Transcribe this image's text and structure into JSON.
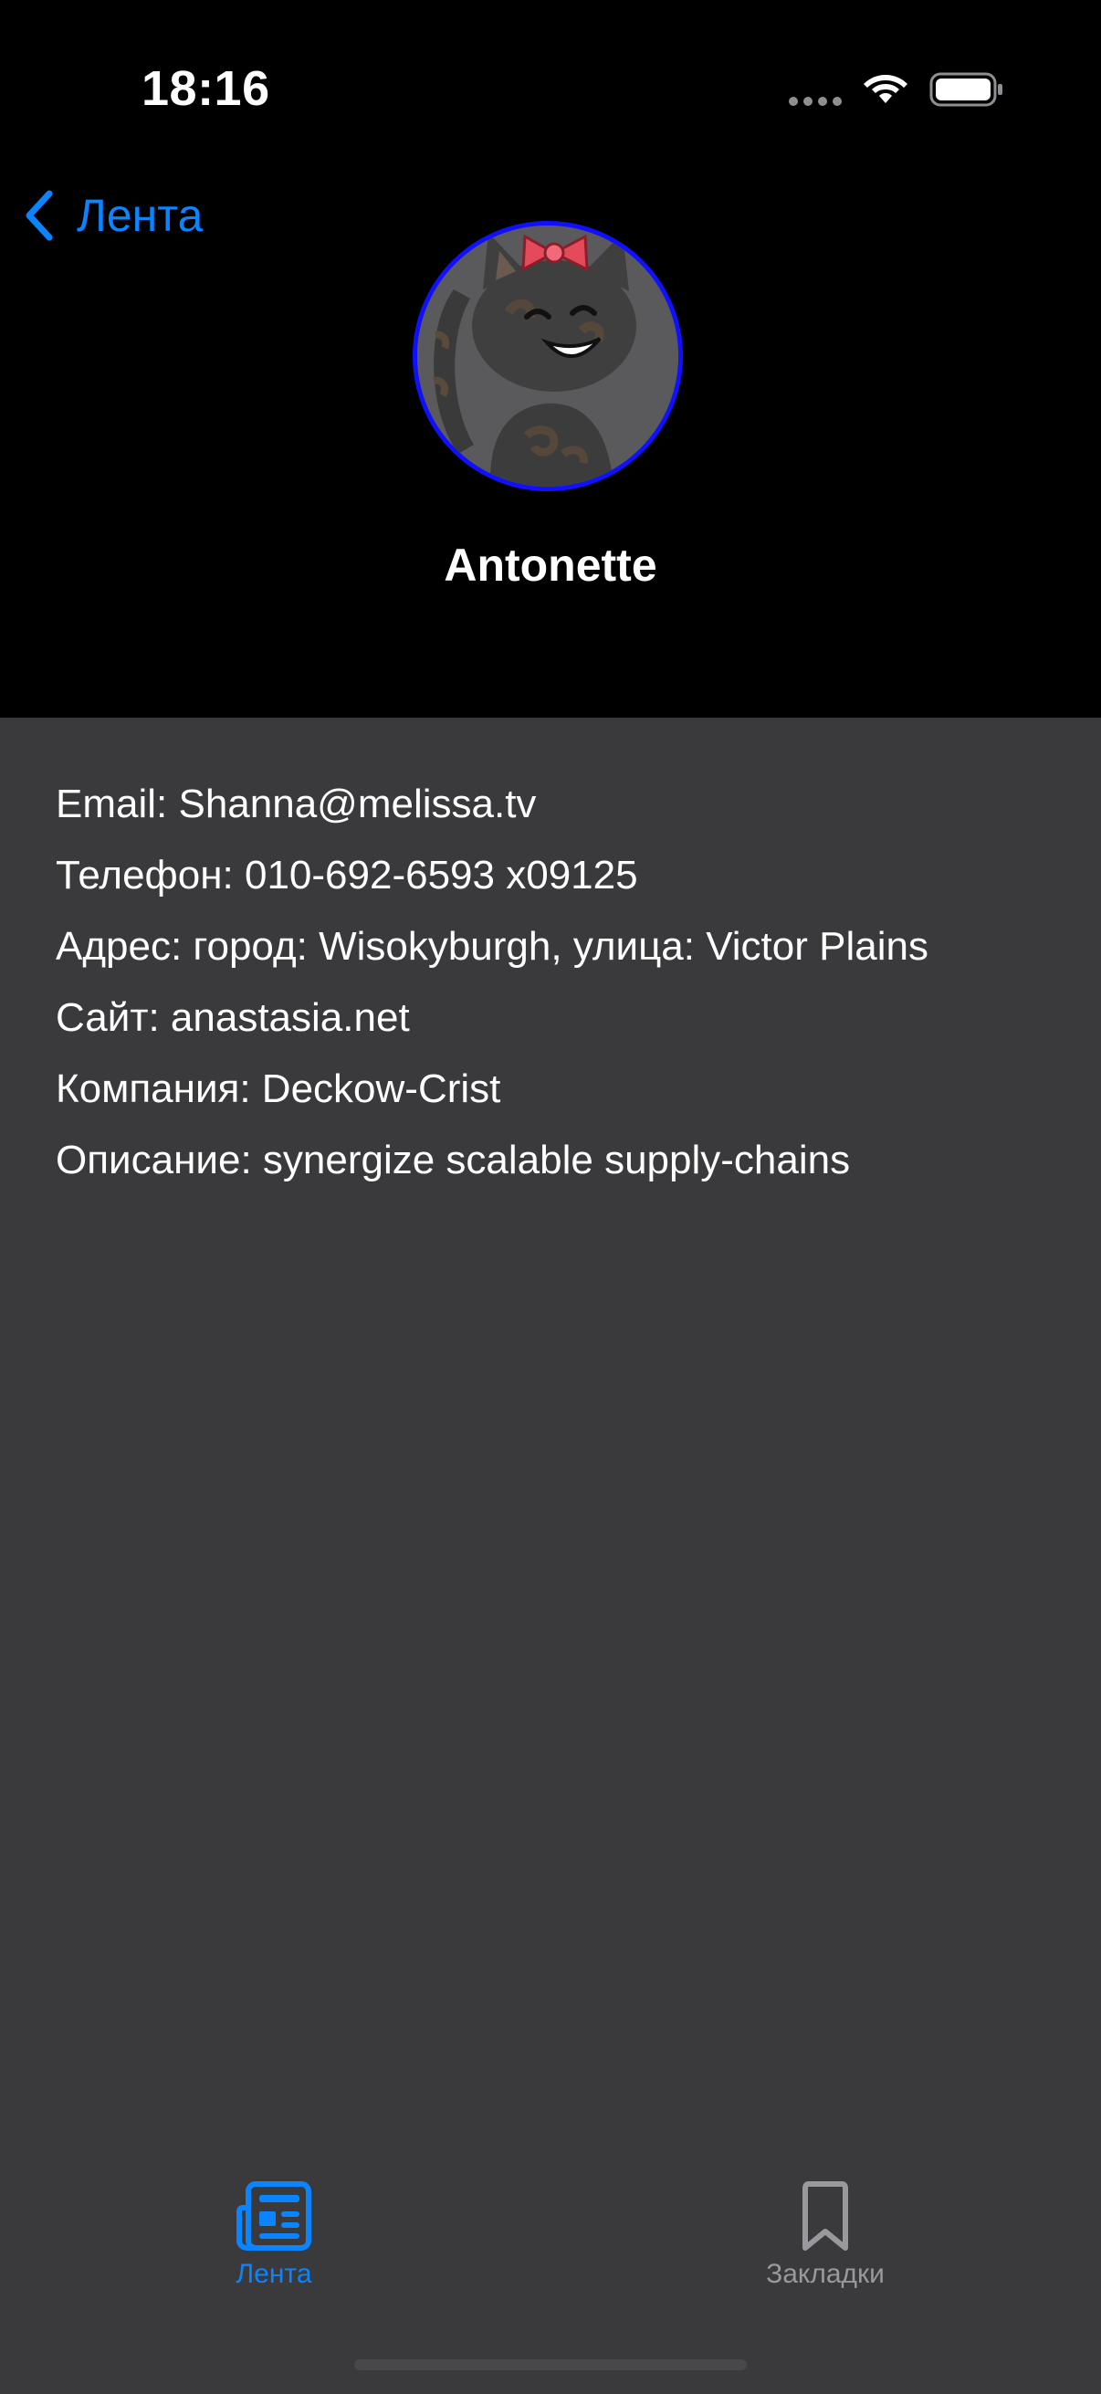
{
  "status_bar": {
    "time": "18:16"
  },
  "nav": {
    "back_label": "Лента"
  },
  "profile": {
    "name": "Antonette",
    "avatar_icon": "cat-avatar-icon"
  },
  "details": [
    {
      "text": "Email: Shanna@melissa.tv"
    },
    {
      "text": "Телефон: 010-692-6593 x09125"
    },
    {
      "text": "Адрес: город: Wisokyburgh, улица: Victor Plains"
    },
    {
      "text": "Сайт: anastasia.net"
    },
    {
      "text": "Компания: Deckow-Crist"
    },
    {
      "text": "Описание: synergize scalable supply-chains"
    }
  ],
  "tab_bar": {
    "tabs": [
      {
        "label": "Лента",
        "icon": "newspaper-icon",
        "selected": true
      },
      {
        "label": "Закладки",
        "icon": "bookmark-icon",
        "selected": false
      }
    ]
  },
  "colors": {
    "accent": "#0a84ff",
    "header_background": "#000000",
    "content_background": "#3a3a3c",
    "avatar_ring": "#1010ff",
    "inactive_tab": "#98989d"
  }
}
